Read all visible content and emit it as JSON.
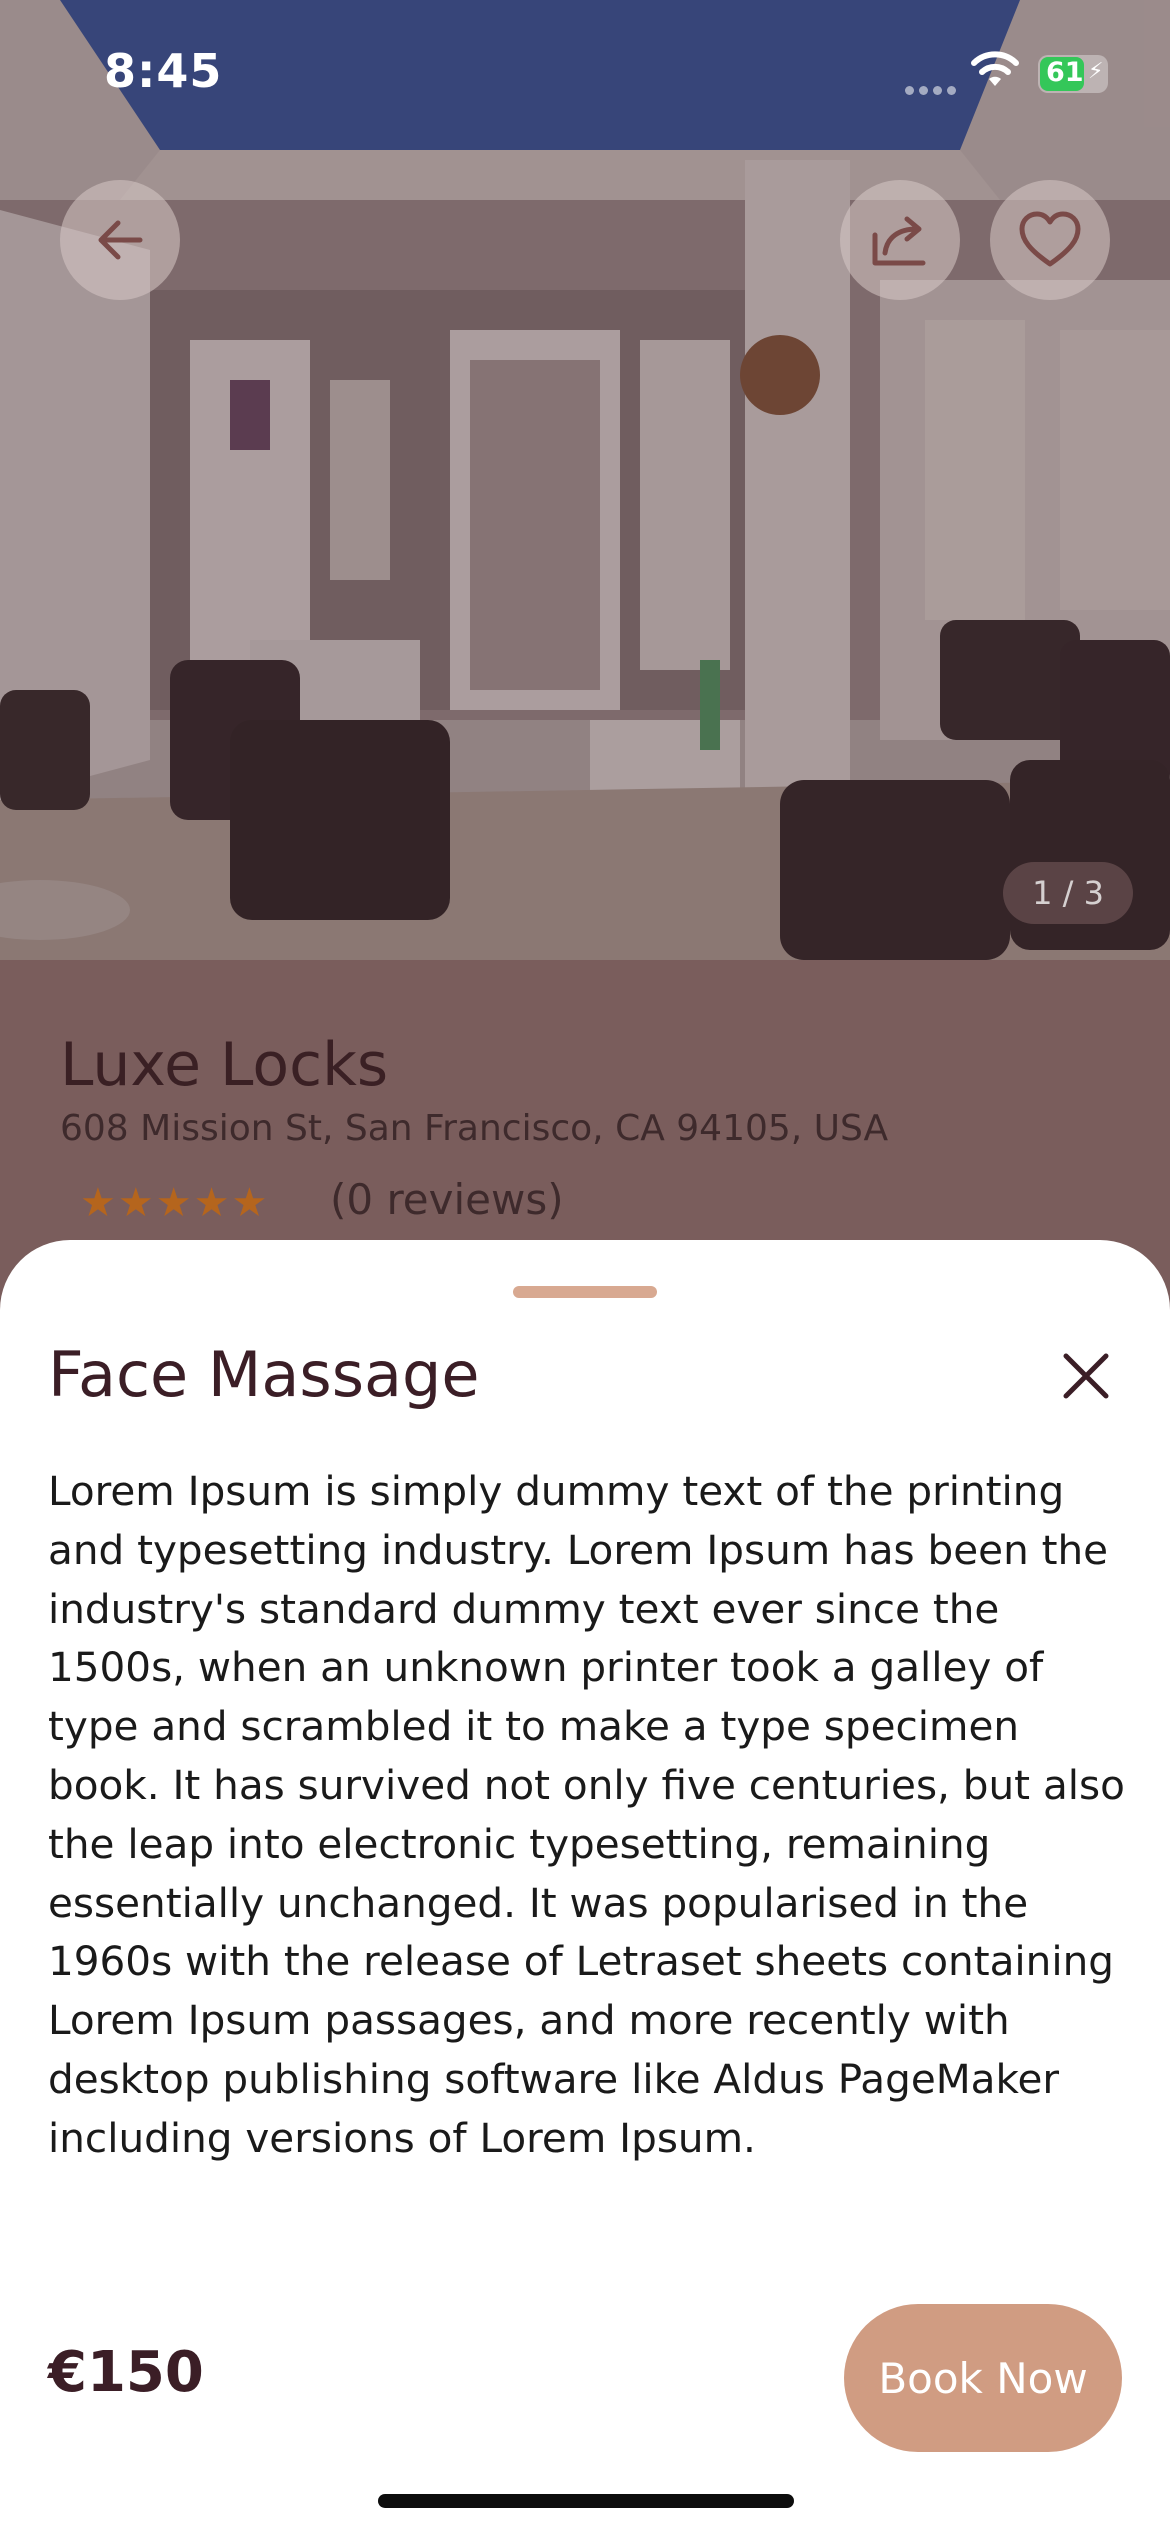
{
  "status_bar": {
    "time": "8:45",
    "battery": "61"
  },
  "gallery": {
    "pager": "1 / 3"
  },
  "salon": {
    "name": "Luxe Locks",
    "address": "608 Mission St, San Francisco, CA 94105, USA",
    "rating_stars": "★★★★★",
    "reviews": "(0 reviews)"
  },
  "sheet": {
    "title": "Face Massage",
    "description": "Lorem Ipsum is simply dummy text of the printing and typesetting industry. Lorem Ipsum has been the industry's standard dummy text ever since the 1500s, when an unknown printer took a galley of type and scrambled it to make a type specimen book. It has survived not only five centuries, but also the leap into electronic typesetting, remaining essentially unchanged. It was popularised in the 1960s with the release of Letraset sheets containing Lorem Ipsum passages, and more recently with desktop publishing software like Aldus PageMaker including versions of Lorem Ipsum.",
    "price": "€150",
    "book_label": "Book Now"
  },
  "colors": {
    "accent": "#d09c82",
    "title_text": "#3b1e26",
    "star": "#b5651d",
    "battery": "#34c759"
  },
  "icons": {
    "back": "arrow-left-icon",
    "share": "share-icon",
    "favorite": "heart-icon",
    "close": "close-icon",
    "wifi": "wifi-icon",
    "battery": "battery-icon"
  }
}
